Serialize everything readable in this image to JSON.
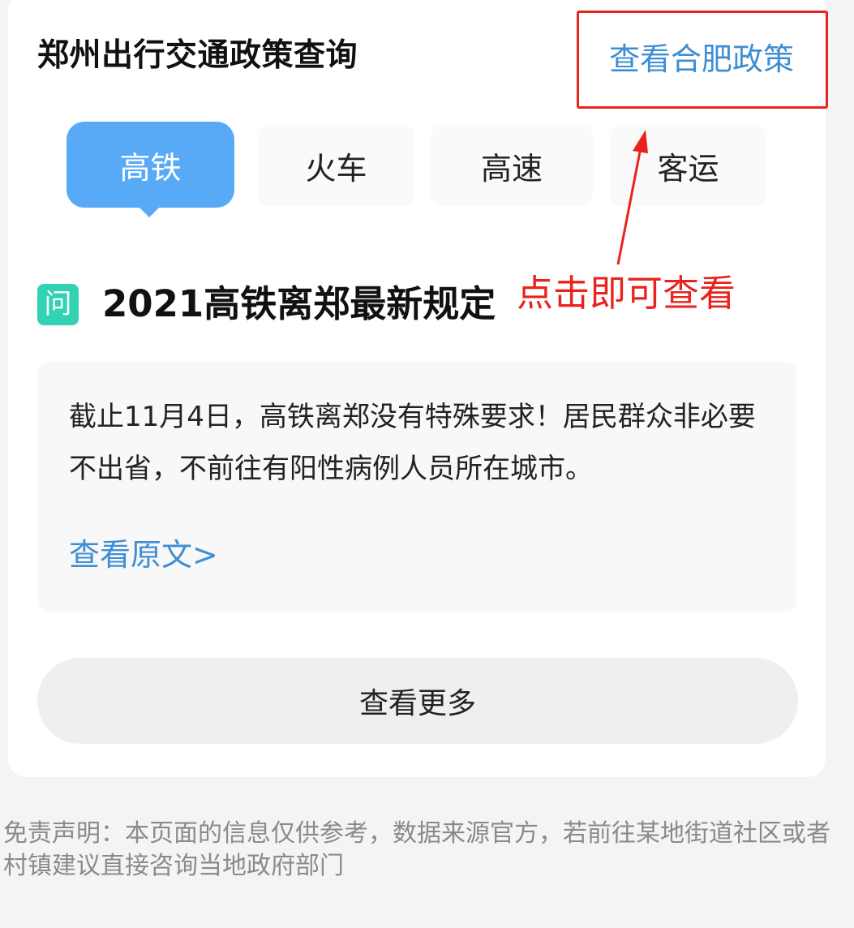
{
  "header": {
    "title": "郑州出行交通政策查询",
    "other_city_link": "查看合肥政策"
  },
  "tabs": [
    {
      "label": "高铁",
      "active": true
    },
    {
      "label": "火车",
      "active": false
    },
    {
      "label": "高速",
      "active": false
    },
    {
      "label": "客运",
      "active": false
    }
  ],
  "annotation": {
    "text": "点击即可查看",
    "color": "#e8231d"
  },
  "qa": {
    "icon_label": "问",
    "question": "2021高铁离郑最新规定",
    "answer": "截止11月4日，高铁离郑没有特殊要求！居民群众非必要不出省，不前往有阳性病例人员所在城市。",
    "original_link": "查看原文>"
  },
  "more_button": "查看更多",
  "disclaimer": "免责声明：本页面的信息仅供参考，数据来源官方，若前往某地街道社区或者村镇建议直接咨询当地政府部门",
  "colors": {
    "accent": "#59aaf6",
    "link": "#3f8ed4",
    "question_icon": "#32d3b4"
  }
}
